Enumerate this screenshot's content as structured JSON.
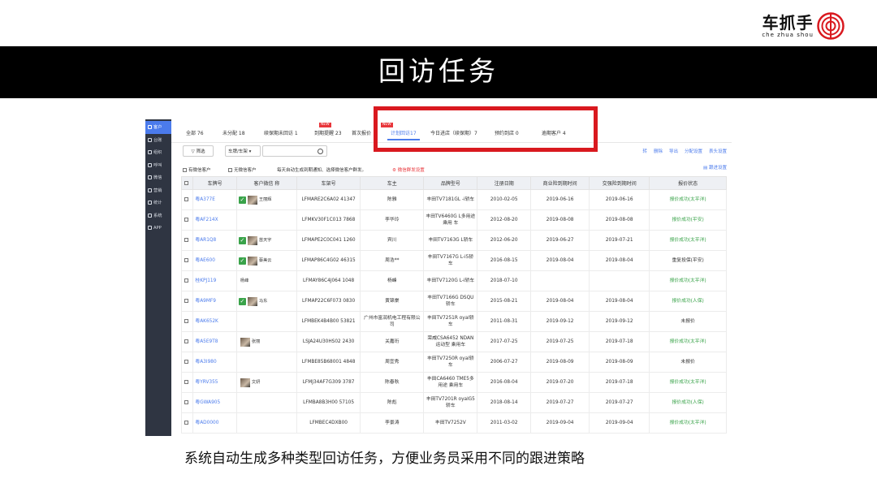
{
  "slide": {
    "logo_main": "车抓手",
    "logo_sub": "che zhua shou",
    "title": "回访任务",
    "caption": "系统自动生成多种类型回访任务，方便业务员采用不同的跟进策略"
  },
  "sidebar": {
    "items": [
      {
        "label": "客户",
        "icon": "user-icon",
        "active": true
      },
      {
        "label": "台账",
        "icon": "ledger-icon",
        "active": false
      },
      {
        "label": "组织",
        "icon": "org-icon",
        "active": false
      },
      {
        "label": "呼叫",
        "icon": "phone-icon",
        "active": false
      },
      {
        "label": "微信",
        "icon": "wechat-icon",
        "active": false
      },
      {
        "label": "营销",
        "icon": "marketing-icon",
        "active": false
      },
      {
        "label": "统计",
        "icon": "chart-icon",
        "active": false
      },
      {
        "label": "系统",
        "icon": "gear-icon",
        "active": false
      },
      {
        "label": "APP",
        "icon": "app-icon",
        "active": false
      }
    ]
  },
  "tabs": [
    {
      "label": "全部 76"
    },
    {
      "label": "未分配 18"
    },
    {
      "label": "续保期未回访 1"
    },
    {
      "label": "到期提醒 23",
      "badge": "NEW"
    },
    {
      "label": "首次报价"
    },
    {
      "label": "计划回访17",
      "badge": "NEW",
      "active": true
    },
    {
      "label": "今日进店（续保期）7"
    },
    {
      "label": "预约到店 0"
    },
    {
      "label": "逾期客户 4"
    }
  ],
  "toolbar": {
    "filter_label": "筛选",
    "select_value": "车牌/车架",
    "search_placeholder": "",
    "actions": [
      "转",
      "删除",
      "导出",
      "分配设置",
      "表头设置"
    ]
  },
  "filters": {
    "has_wechat": "有微信客户",
    "no_wechat": "无微信客户",
    "notice": "每天自动生成到期通知、选择微信客户群发。",
    "wechat_settings": "微信群发设置",
    "progress_settings": "跟进设置"
  },
  "table": {
    "headers": [
      "车牌号",
      "客户微信 称",
      "车架号",
      "车主",
      "品牌型号",
      "注册日期",
      "商业险到期时间",
      "交强险到期时间",
      "报价状态"
    ],
    "rows": [
      {
        "plate": "粤A377E",
        "wx": true,
        "wx_name": "王丽辉",
        "vin": "LFMARE2C6A02 41347",
        "owner": "陈雅",
        "model": "丰田TV7181GL -i轿车",
        "reg": "2010-02-05",
        "biz": "2019-06-16",
        "comp": "2019-06-16",
        "status": "报价成功(太平洋)",
        "ok": true
      },
      {
        "plate": "粤AF214X",
        "wx": false,
        "wx_name": "",
        "vin": "LFMKV30F1C013 7868",
        "owner": "李华玲",
        "model": "丰田TV6460G L多用途乘用 车",
        "reg": "2012-08-20",
        "biz": "2019-08-08",
        "comp": "2019-08-08",
        "status": "报价成功(平安)",
        "ok": true
      },
      {
        "plate": "粤AR1Q8",
        "wx": true,
        "wx_name": "苗天宇",
        "vin": "LFMAPE2C0C041 1260",
        "owner": "宾川",
        "model": "丰田TV7163G L轿车",
        "reg": "2012-06-20",
        "biz": "2019-06-27",
        "comp": "2019-07-21",
        "status": "报价成功(太平洋)",
        "ok": true
      },
      {
        "plate": "粤AE600",
        "wx": true,
        "wx_name": "蔡美云",
        "vin": "LFMAP86C4G02 46315",
        "owner": "周浩**",
        "model": "丰田TV7167G L-i5轿车",
        "reg": "2016-08-15",
        "biz": "2019-08-04",
        "comp": "2019-08-04",
        "status": "重复投保(平安)",
        "ok": false
      },
      {
        "plate": "桂KPJ119",
        "wx": false,
        "wx_name": "杨峰",
        "vin": "LFMAY86C4J064 1048",
        "owner": "杨峰",
        "model": "丰田TV7120G L-i轿车",
        "reg": "2018-07-10",
        "biz": "",
        "comp": "",
        "status": "报价成功(太平洋)",
        "ok": true
      },
      {
        "plate": "粤A9MF9",
        "wx": true,
        "wx_name": "马东",
        "vin": "LFMAP22C6F073 0830",
        "owner": "黄锦棠",
        "model": "丰田TV7166G DSQU轿车",
        "reg": "2015-08-21",
        "biz": "2019-08-04",
        "comp": "2019-08-04",
        "status": "报价成功(人保)",
        "ok": true
      },
      {
        "plate": "粤AK652K",
        "wx": false,
        "wx_name": "",
        "vin": "LFMBEK4B4B00 53821",
        "owner": "广州市富润机电工程有限公司",
        "model": "丰田TV7251R oyal轿车",
        "reg": "2011-08-31",
        "biz": "2019-09-12",
        "comp": "2019-09-12",
        "status": "未报价",
        "ok": false
      },
      {
        "plate": "粤A5E9T8",
        "wx": false,
        "avatar": true,
        "wx_name": "张丽",
        "vin": "LSJA24U30HS02 2430",
        "owner": "关嘉珩",
        "model": "荣威CSA6452 NDAN运动型 乘用车",
        "reg": "2017-07-25",
        "biz": "2019-07-25",
        "comp": "2019-07-18",
        "status": "报价成功(太平洋)",
        "ok": true
      },
      {
        "plate": "粤A3I980",
        "wx": false,
        "wx_name": "",
        "vin": "LFMBE85B68001 4848",
        "owner": "周宜秀",
        "model": "丰田TV7250R oyal轿车",
        "reg": "2006-07-27",
        "biz": "2019-08-09",
        "comp": "2019-08-09",
        "status": "未报价",
        "ok": false
      },
      {
        "plate": "粤YRV355",
        "wx": false,
        "avatar": true,
        "wx_name": "文妍",
        "vin": "LFMJ34AF7G309 3787",
        "owner": "陈春秋",
        "model": "丰田CA6460 TME5多用途 乘用车",
        "reg": "2016-08-04",
        "biz": "2019-07-20",
        "comp": "2019-07-18",
        "status": "报价成功(太平洋)",
        "ok": true
      },
      {
        "plate": "粤GWA905",
        "wx": false,
        "wx_name": "",
        "vin": "LFMBA8B3H00 57105",
        "owner": "陈彪",
        "model": "丰田TV7201R oyalG5轿车",
        "reg": "2018-08-14",
        "biz": "2019-07-27",
        "comp": "2019-07-27",
        "status": "报价成功(人保)",
        "ok": true
      },
      {
        "plate": "粤AD0000",
        "wx": false,
        "wx_name": "",
        "vin": "LFMBEC4DXB00",
        "owner": "李景涛",
        "model": "丰田TV7252V",
        "reg": "2011-03-02",
        "biz": "2019-09-04",
        "comp": "2019-09-04",
        "status": "报价成功(太平洋)",
        "ok": true
      }
    ]
  }
}
